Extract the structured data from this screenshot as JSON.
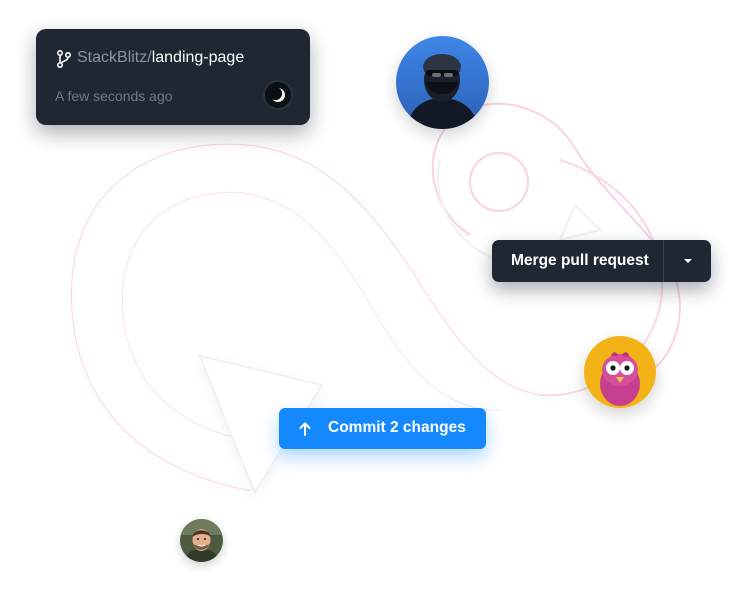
{
  "repo_card": {
    "owner": "StackBlitz",
    "separator": "/",
    "repo": "landing-page",
    "timestamp": "A few seconds ago",
    "branch_icon": "git-branch-icon",
    "mini_avatar": "moon-avatar"
  },
  "merge": {
    "label": "Merge pull request",
    "dropdown_icon": "caret-down-icon"
  },
  "commit": {
    "label": "Commit 2 changes",
    "icon": "arrow-up-icon"
  },
  "avatars": {
    "top": "user-avatar-masked",
    "right": "pink-bird-avatar",
    "bottom": "user-avatar-bearded"
  },
  "colors": {
    "card_bg": "#1f2733",
    "accent_blue": "#1389fd",
    "muted_text": "#8b94a3",
    "decor_pink": "#f4c6dd"
  }
}
